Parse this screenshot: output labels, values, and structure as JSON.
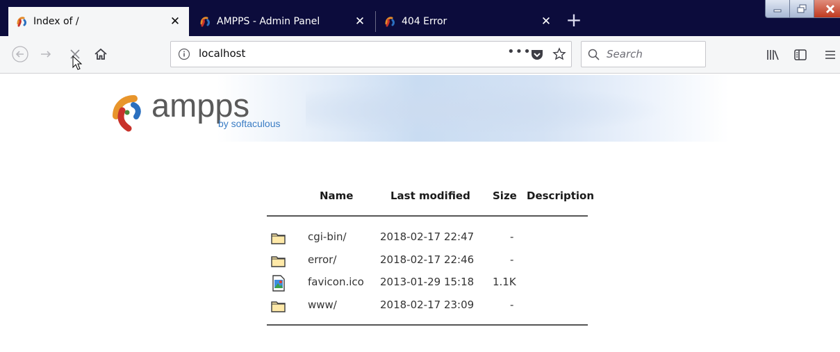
{
  "browser": {
    "tabs": [
      {
        "title": "Index of /",
        "active": true
      },
      {
        "title": "AMPPS - Admin Panel",
        "active": false
      },
      {
        "title": "404 Error",
        "active": false
      }
    ],
    "url": "localhost",
    "search_placeholder": "Search",
    "page_actions": "•••",
    "colors": {
      "tabstrip": "#0c0c3c",
      "toolbar": "#f5f6f7",
      "close_button": "#c0391f"
    }
  },
  "page": {
    "logo": {
      "name": "ampps",
      "sub": "by softaculous"
    },
    "table": {
      "headers": {
        "name": "Name",
        "modified": "Last modified",
        "size": "Size",
        "description": "Description"
      },
      "rows": [
        {
          "icon": "folder-icon",
          "name": "cgi-bin/",
          "modified": "2018-02-17 22:47",
          "size": "-",
          "description": ""
        },
        {
          "icon": "folder-icon",
          "name": "error/",
          "modified": "2018-02-17 22:46",
          "size": "-",
          "description": ""
        },
        {
          "icon": "image-file-icon",
          "name": "favicon.ico",
          "modified": "2013-01-29 15:18",
          "size": "1.1K",
          "description": ""
        },
        {
          "icon": "folder-icon",
          "name": "www/",
          "modified": "2018-02-17 23:09",
          "size": "-",
          "description": ""
        }
      ]
    }
  }
}
